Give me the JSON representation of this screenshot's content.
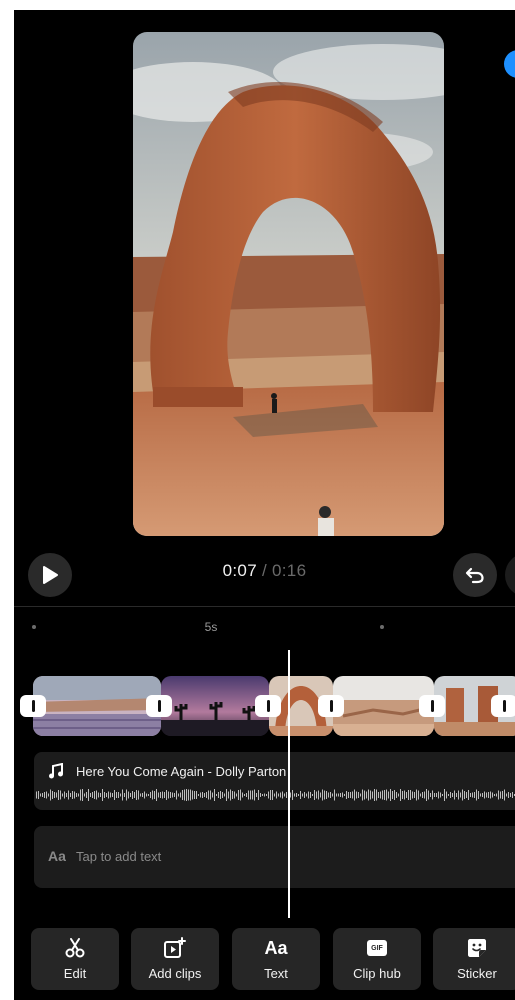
{
  "player": {
    "current_time": "0:07",
    "separator": " / ",
    "total_time": "0:16"
  },
  "ruler": {
    "label": "5s"
  },
  "audio": {
    "title": "Here You Come Again - Dolly Parton"
  },
  "text_track": {
    "icon_label": "Aa",
    "placeholder": "Tap to add text"
  },
  "toolbar": {
    "items": [
      {
        "label": "Edit",
        "icon": "scissors-icon"
      },
      {
        "label": "Add clips",
        "icon": "add-clip-icon"
      },
      {
        "label": "Text",
        "icon": "text-aa-icon",
        "glyph": "Aa"
      },
      {
        "label": "Clip hub",
        "icon": "gif-icon",
        "glyph": "GIF"
      },
      {
        "label": "Sticker",
        "icon": "sticker-icon"
      }
    ]
  },
  "colors": {
    "background": "#000000",
    "panel": "#1c1c1c",
    "button": "#262626",
    "accent": "#1e90ff"
  }
}
